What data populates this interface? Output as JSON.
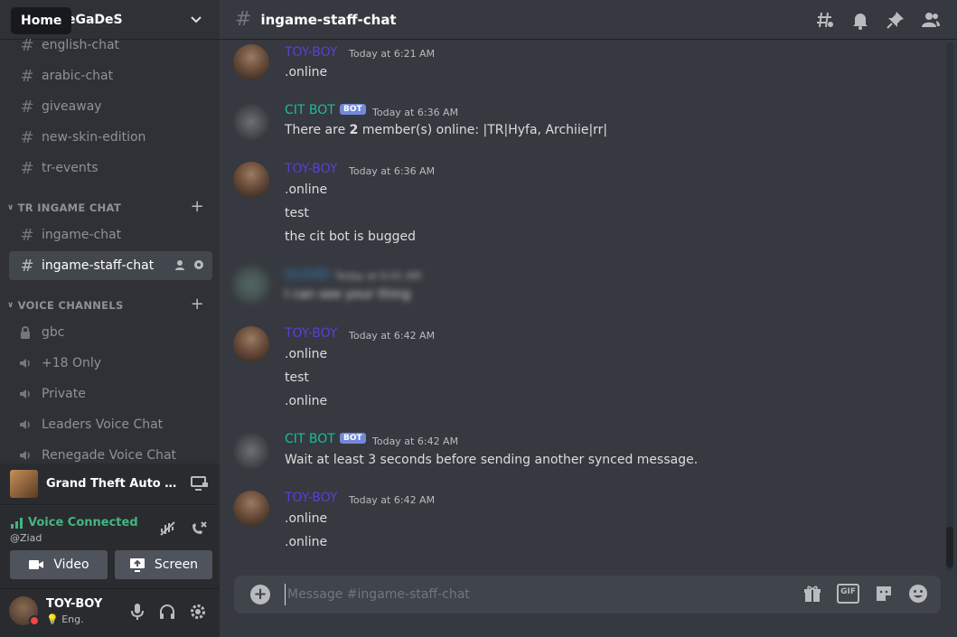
{
  "tooltip": {
    "home": "Home"
  },
  "server": {
    "name": "eGaDeS"
  },
  "channels_top": [
    {
      "name": "english-chat"
    },
    {
      "name": "arabic-chat"
    },
    {
      "name": "giveaway"
    },
    {
      "name": "new-skin-edition"
    },
    {
      "name": "tr-events"
    }
  ],
  "category_ingame": {
    "name": "TR INGAME CHAT"
  },
  "channels_ingame": [
    {
      "name": "ingame-chat"
    },
    {
      "name": "ingame-staff-chat"
    }
  ],
  "category_voice": {
    "name": "VOICE CHANNELS"
  },
  "voice_channels": [
    {
      "name": "gbc",
      "icon": "lock-icon"
    },
    {
      "name": "+18 Only",
      "icon": "speaker-icon"
    },
    {
      "name": "Private",
      "icon": "speaker-icon"
    },
    {
      "name": "Leaders Voice Chat",
      "icon": "speaker-icon"
    },
    {
      "name": "Renegade Voice Chat",
      "icon": "speaker-icon"
    }
  ],
  "activity": {
    "title": "Grand Theft Auto San ..."
  },
  "voice_panel": {
    "status": "Voice Connected",
    "sub": "@Ziad",
    "video_label": "Video",
    "screen_label": "Screen"
  },
  "user": {
    "name": "TOY-BOY",
    "status": "Eng."
  },
  "chat": {
    "channel_name": "ingame-staff-chat"
  },
  "messages": [
    {
      "author": "TOY-BOY",
      "time": "Today at 6:21 AM",
      "lines": [
        ".online"
      ]
    },
    {
      "author": "CIT BOT",
      "badge": "BOT",
      "time": "Today at 6:36 AM",
      "lines_pre": "There are ",
      "count": "2",
      "lines_post": " member(s) online: |TR|Hyfa, Archiie|rr|"
    },
    {
      "author": "TOY-BOY",
      "time": "Today at 6:36 AM",
      "lines": [
        ".online",
        "test",
        "the cit bot is bugged"
      ]
    },
    {
      "author": "Ov3rDr",
      "time": "Today at 6:41 AM",
      "lines": [
        "I can see your thing"
      ]
    },
    {
      "author": "TOY-BOY",
      "time": "Today at 6:42 AM",
      "lines": [
        ".online",
        "test",
        ".online"
      ]
    },
    {
      "author": "CIT BOT",
      "badge": "BOT",
      "time": "Today at 6:42 AM",
      "lines": [
        "Wait at least 3 seconds before sending another synced message."
      ]
    },
    {
      "author": "TOY-BOY",
      "time": "Today at 6:42 AM",
      "lines": [
        ".online",
        ".online"
      ]
    }
  ],
  "composer": {
    "placeholder": "Message #ingame-staff-chat",
    "gif_label": "GIF"
  },
  "colors": {
    "toy_boy": "#5b3ed6",
    "cit_bot": "#1abc9c",
    "voice_connected": "#43b581",
    "bot_badge": "#7289da"
  }
}
